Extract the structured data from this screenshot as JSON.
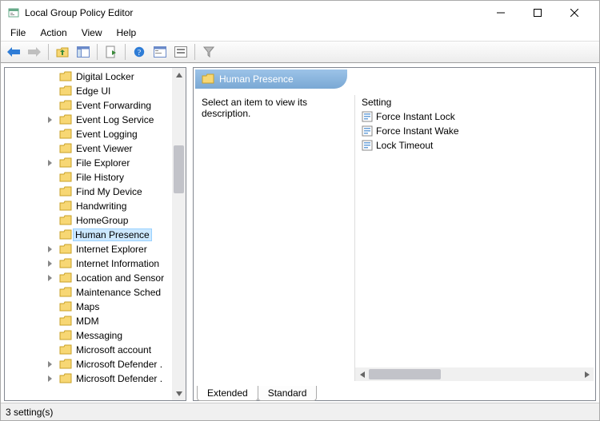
{
  "window": {
    "title": "Local Group Policy Editor"
  },
  "menus": [
    "File",
    "Action",
    "View",
    "Help"
  ],
  "tree": {
    "items": [
      {
        "label": "Digital Locker",
        "expandable": false
      },
      {
        "label": "Edge UI",
        "expandable": false
      },
      {
        "label": "Event Forwarding",
        "expandable": false
      },
      {
        "label": "Event Log Service",
        "expandable": true
      },
      {
        "label": "Event Logging",
        "expandable": false
      },
      {
        "label": "Event Viewer",
        "expandable": false
      },
      {
        "label": "File Explorer",
        "expandable": true
      },
      {
        "label": "File History",
        "expandable": false
      },
      {
        "label": "Find My Device",
        "expandable": false
      },
      {
        "label": "Handwriting",
        "expandable": false
      },
      {
        "label": "HomeGroup",
        "expandable": false
      },
      {
        "label": "Human Presence",
        "expandable": false,
        "selected": true
      },
      {
        "label": "Internet Explorer",
        "expandable": true
      },
      {
        "label": "Internet Information",
        "expandable": true
      },
      {
        "label": "Location and Sensor",
        "expandable": true
      },
      {
        "label": "Maintenance Sched",
        "expandable": false
      },
      {
        "label": "Maps",
        "expandable": false
      },
      {
        "label": "MDM",
        "expandable": false
      },
      {
        "label": "Messaging",
        "expandable": false
      },
      {
        "label": "Microsoft account",
        "expandable": false
      },
      {
        "label": "Microsoft Defender .",
        "expandable": true
      },
      {
        "label": "Microsoft Defender .",
        "expandable": true
      }
    ]
  },
  "detail": {
    "header": "Human Presence",
    "description": "Select an item to view its description.",
    "settings_header": "Setting",
    "settings": [
      "Force Instant Lock",
      "Force Instant Wake",
      "Lock Timeout"
    ]
  },
  "tabs": {
    "extended": "Extended",
    "standard": "Standard"
  },
  "status": "3 setting(s)"
}
